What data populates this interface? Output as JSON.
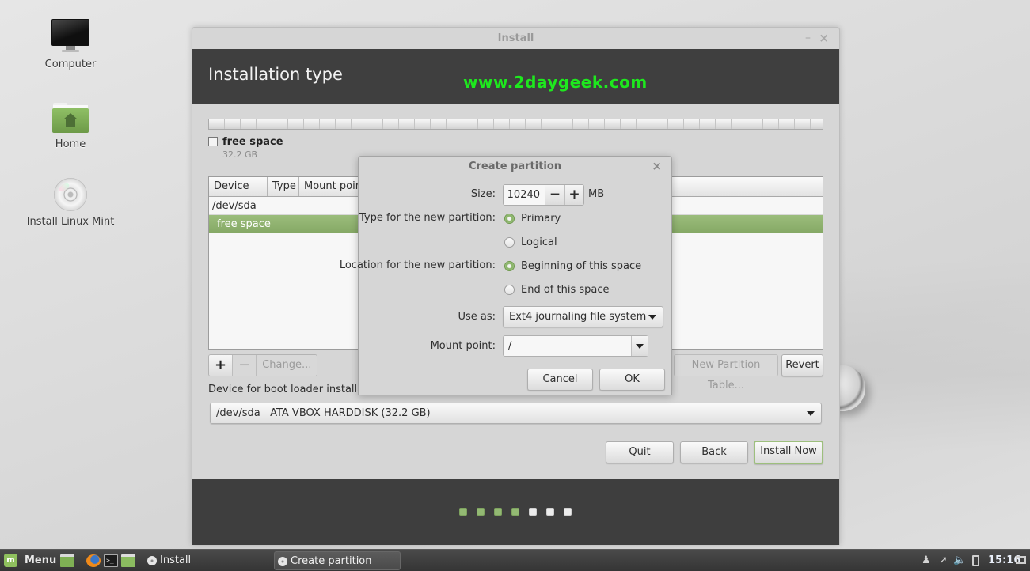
{
  "desktop": {
    "icons": [
      {
        "label": "Computer",
        "icon": "computer-icon"
      },
      {
        "label": "Home",
        "icon": "home-folder-icon"
      },
      {
        "label": "Install Linux Mint",
        "icon": "cd-disc-icon"
      }
    ]
  },
  "install_window": {
    "title": "Install",
    "minimize_glyph": "–",
    "close_glyph": "×",
    "heading": "Installation type",
    "watermark": "www.2daygeek.com",
    "disk_legend": {
      "name": "free space",
      "size": "32.2 GB"
    },
    "partition_table": {
      "columns": [
        "Device",
        "Type",
        "Mount point"
      ],
      "rows": [
        {
          "device": "/dev/sda",
          "selected": false
        },
        {
          "device": "free space",
          "selected": true
        }
      ]
    },
    "toolbar": {
      "add_label": "+",
      "remove_label": "−",
      "change_label": "Change...",
      "new_partition_table_label": "New Partition Table...",
      "revert_label": "Revert"
    },
    "bootloader": {
      "label": "Device for boot loader installation:",
      "selected": "/dev/sda   ATA VBOX HARDDISK (32.2 GB)"
    },
    "buttons": {
      "quit": "Quit",
      "back": "Back",
      "install_now": "Install Now"
    },
    "progress": {
      "total_steps": 7,
      "completed_steps": 4
    },
    "colors": {
      "accent": "#8fb86c",
      "header_bg": "#3f3f3f",
      "watermark": "#1ee81e"
    }
  },
  "dialog": {
    "title": "Create partition",
    "close_glyph": "×",
    "size_label": "Size:",
    "size_value": "10240",
    "size_unit": "MB",
    "decrement": "−",
    "increment": "+",
    "type_label": "Type for the new partition:",
    "type_options": [
      {
        "label": "Primary",
        "selected": true
      },
      {
        "label": "Logical",
        "selected": false
      }
    ],
    "location_label": "Location for the new partition:",
    "location_options": [
      {
        "label": "Beginning of this space",
        "selected": true
      },
      {
        "label": "End of this space",
        "selected": false
      }
    ],
    "use_as_label": "Use as:",
    "use_as_value": "Ext4 journaling file system",
    "mount_label": "Mount point:",
    "mount_value": "/",
    "cancel": "Cancel",
    "ok": "OK"
  },
  "taskbar": {
    "menu_label": "Menu",
    "tasks": [
      {
        "label": "Install",
        "active": false
      },
      {
        "label": "Create partition",
        "active": true
      }
    ],
    "clock": "15:16"
  }
}
